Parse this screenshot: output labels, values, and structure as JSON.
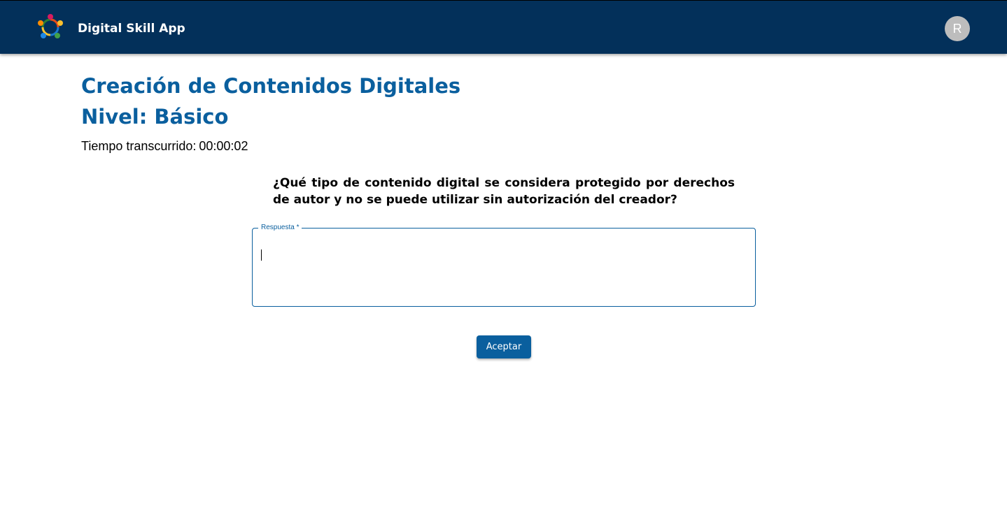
{
  "appbar": {
    "title": "Digital Skill App",
    "logo_icon": "people-circle-logo-icon",
    "avatar_initial": "R",
    "background_color": "#03305a"
  },
  "main": {
    "title": "Creación de Contenidos Digitales",
    "level": "Nivel: Básico",
    "timer_label": "Tiempo transcurrido:",
    "timer_value": "00:00:02",
    "question": "¿Qué tipo de contenido digital se considera protegido por derechos de autor y no se puede utilizar sin autorización del creador?",
    "answer": {
      "label": "Respuesta *",
      "value": ""
    },
    "accept_label": "Aceptar",
    "accent_color": "#0a5f9e"
  }
}
